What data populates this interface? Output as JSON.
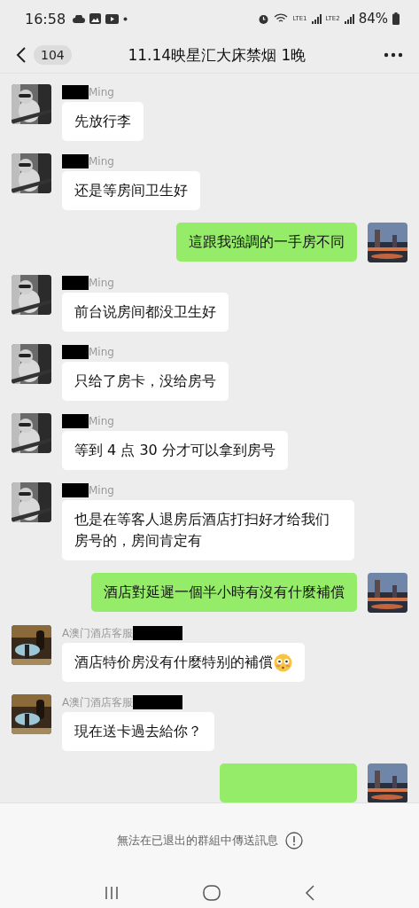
{
  "status_bar": {
    "time": "16:58",
    "network_1": "LTE1",
    "network_2": "LTE2",
    "battery": "84%"
  },
  "header": {
    "unread": "104",
    "title": "11.14映星汇大床禁烟 1晚"
  },
  "messages": [
    {
      "kind": "incoming",
      "sender": "Ming",
      "redaction_first": true,
      "text": "先放行李"
    },
    {
      "kind": "incoming",
      "sender": "Ming",
      "redaction_first": true,
      "text": "还是等房间卫生好"
    },
    {
      "kind": "outgoing",
      "text": "這跟我強調的一手房不同"
    },
    {
      "kind": "incoming",
      "sender": "Ming",
      "redaction_first": true,
      "text": "前台说房间都没卫生好"
    },
    {
      "kind": "incoming",
      "sender": "Ming",
      "redaction_first": true,
      "text": "只给了房卡，没给房号"
    },
    {
      "kind": "incoming",
      "sender": "Ming",
      "redaction_first": true,
      "text": "等到 4 点 30 分才可以拿到房号"
    },
    {
      "kind": "incoming",
      "sender": "Ming",
      "redaction_first": true,
      "text": "也是在等客人退房后酒店打扫好才给我们房号的，房间肯定有"
    },
    {
      "kind": "outgoing",
      "text": "酒店對延遲一個半小時有沒有什麼補償"
    },
    {
      "kind": "incoming",
      "sender": "A澳门酒店客服",
      "redaction_first": false,
      "text": "酒店特价房没有什麼特别的補償",
      "emoji": true
    },
    {
      "kind": "incoming",
      "sender": "A澳门酒店客服",
      "redaction_first": false,
      "text": "現在送卡過去給你？"
    },
    {
      "kind": "outgoing",
      "partial": true
    }
  ],
  "notice": "無法在已退出的群組中傳送訊息"
}
